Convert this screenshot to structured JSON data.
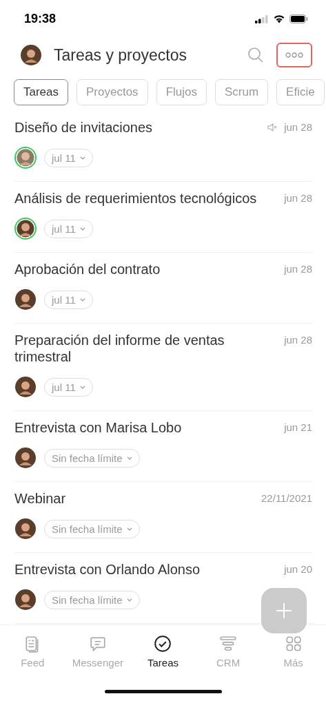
{
  "status_bar": {
    "time": "19:38"
  },
  "header": {
    "title": "Tareas y proyectos"
  },
  "tabs": [
    {
      "label": "Tareas",
      "selected": true
    },
    {
      "label": "Proyectos",
      "selected": false
    },
    {
      "label": "Flujos",
      "selected": false
    },
    {
      "label": "Scrum",
      "selected": false
    },
    {
      "label": "Eficie",
      "selected": false
    }
  ],
  "tasks": [
    {
      "title": "Diseño de invitaciones",
      "date": "jun 28",
      "muted": true,
      "online": true,
      "deadline": "jul 11"
    },
    {
      "title": "Análisis de requerimientos tecnológicos",
      "date": "jun 28",
      "muted": false,
      "online": true,
      "deadline": "jul 11"
    },
    {
      "title": "Aprobación del contrato",
      "date": "jun 28",
      "muted": false,
      "online": false,
      "deadline": "jul 11"
    },
    {
      "title": "Preparación del informe de ventas trimestral",
      "date": "jun 28",
      "muted": false,
      "online": false,
      "deadline": "jul 11"
    },
    {
      "title": "Entrevista con Marisa Lobo",
      "date": "jun 21",
      "muted": false,
      "online": false,
      "deadline": "Sin fecha límite"
    },
    {
      "title": "Webinar",
      "date": "22/11/2021",
      "muted": false,
      "online": false,
      "deadline": "Sin fecha límite"
    },
    {
      "title": "Entrevista con Orlando Alonso",
      "date": "jun 20",
      "muted": false,
      "online": false,
      "deadline": "Sin fecha límite"
    }
  ],
  "bottom_nav": [
    {
      "label": "Feed",
      "kind": "feed",
      "selected": false
    },
    {
      "label": "Messenger",
      "kind": "messenger",
      "selected": false
    },
    {
      "label": "Tareas",
      "kind": "tasks",
      "selected": true
    },
    {
      "label": "CRM",
      "kind": "crm",
      "selected": false
    },
    {
      "label": "Más",
      "kind": "more",
      "selected": false
    }
  ]
}
